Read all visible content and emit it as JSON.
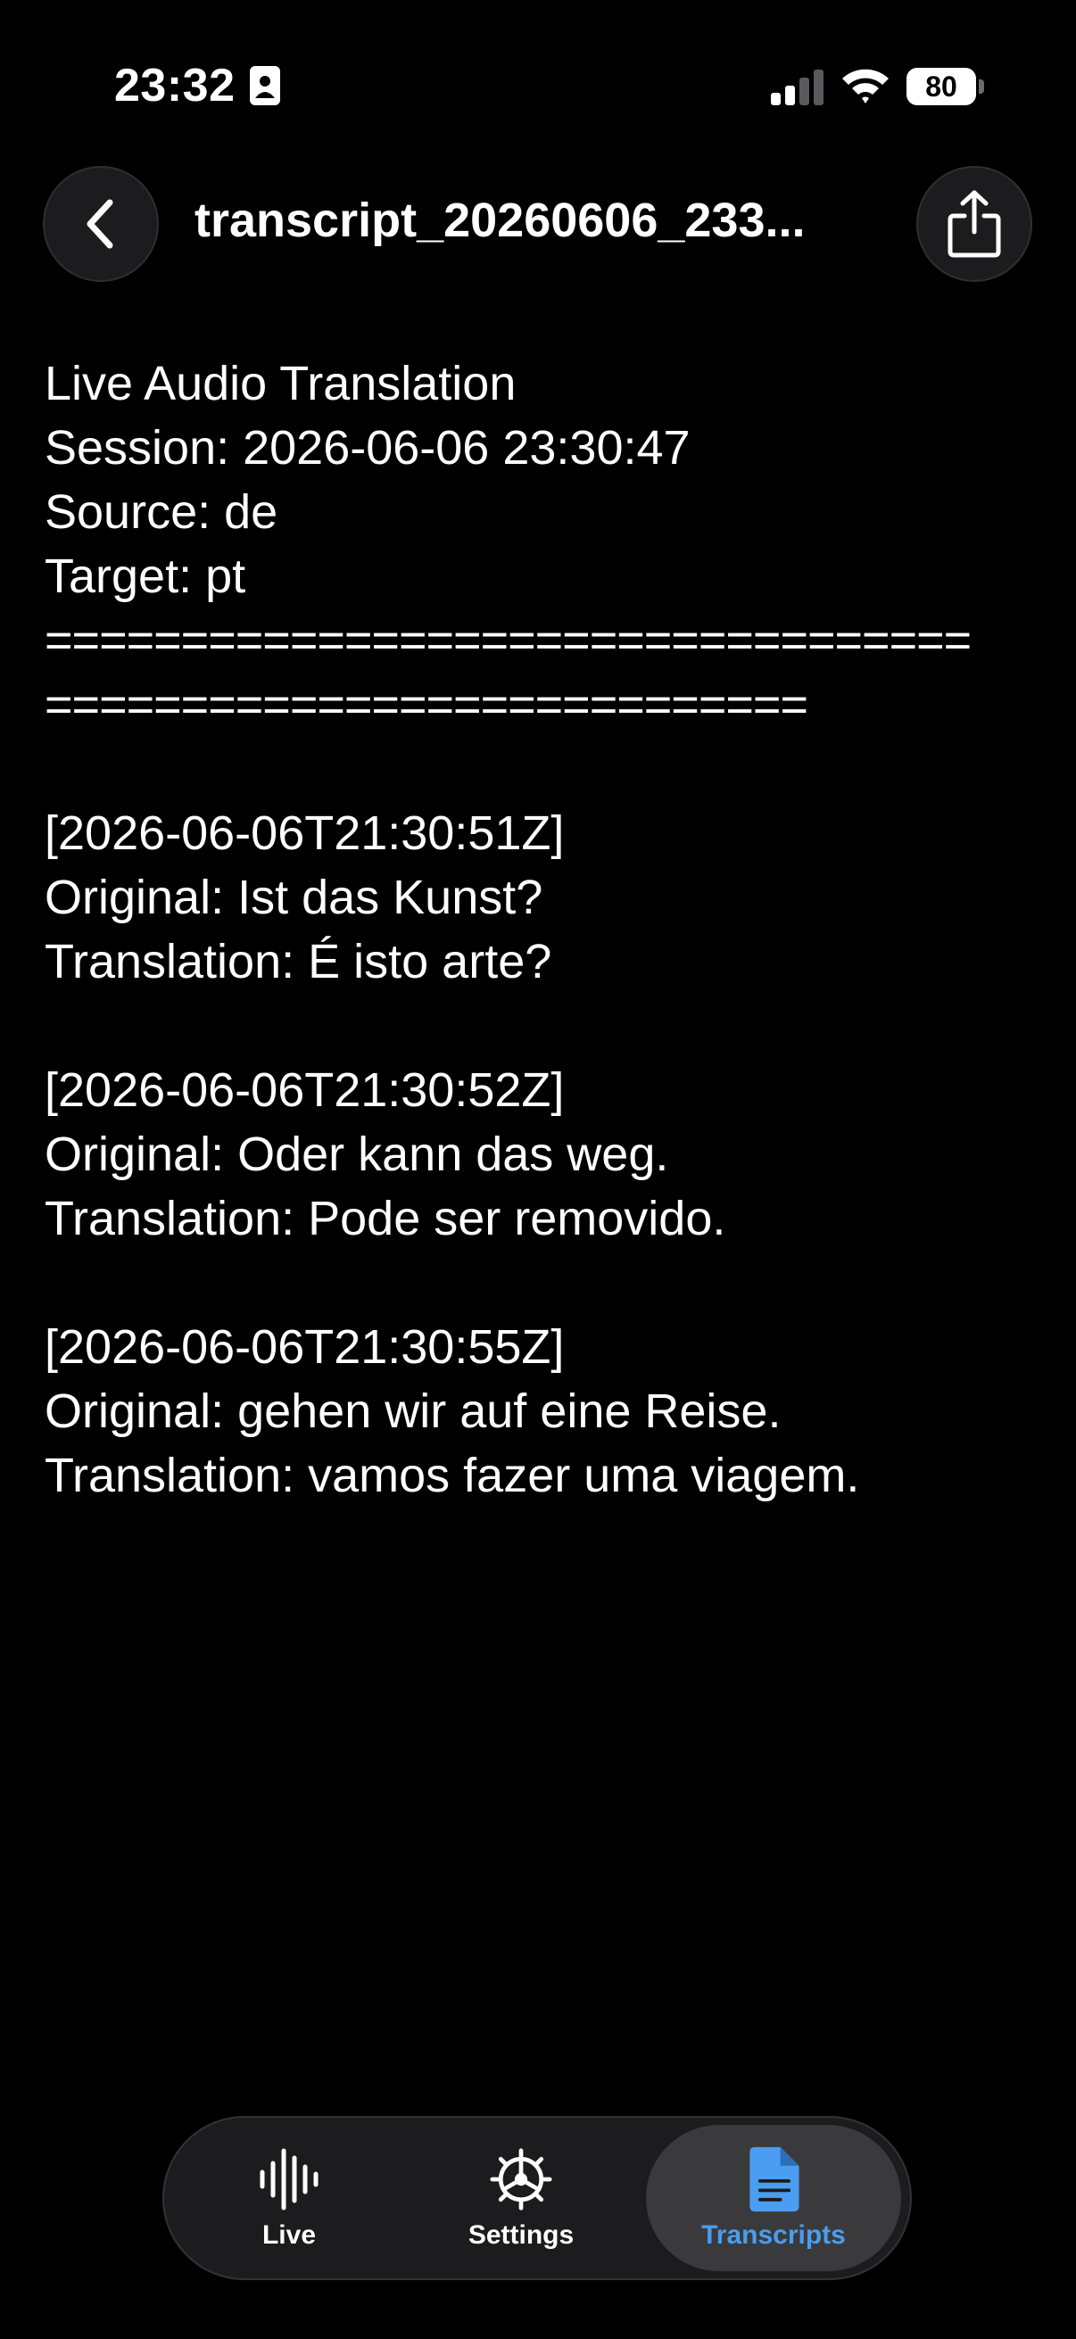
{
  "status_bar": {
    "time": "23:32",
    "battery_level": "80"
  },
  "header": {
    "title": "transcript_20260606_233..."
  },
  "transcript": {
    "header_lines": [
      "Live Audio Translation",
      "Session: 2026-06-06 23:30:47",
      "Source: de",
      "Target: pt"
    ],
    "separator_lines": [
      "==================================",
      "============================"
    ],
    "entries": [
      {
        "timestamp": "[2026-06-06T21:30:51Z]",
        "original": "Original: Ist das Kunst?",
        "translation": "Translation: É isto arte?"
      },
      {
        "timestamp": "[2026-06-06T21:30:52Z]",
        "original": "Original: Oder kann das weg.",
        "translation": "Translation: Pode ser removido."
      },
      {
        "timestamp": "[2026-06-06T21:30:55Z]",
        "original": "Original: gehen wir auf eine Reise.",
        "translation": "Translation: vamos fazer uma viagem."
      }
    ]
  },
  "tab_bar": {
    "tabs": [
      {
        "label": "Live",
        "icon": "waveform-icon"
      },
      {
        "label": "Settings",
        "icon": "gear-icon"
      },
      {
        "label": "Transcripts",
        "icon": "document-icon",
        "selected": true
      }
    ],
    "accent_color": "#4a9df0"
  }
}
